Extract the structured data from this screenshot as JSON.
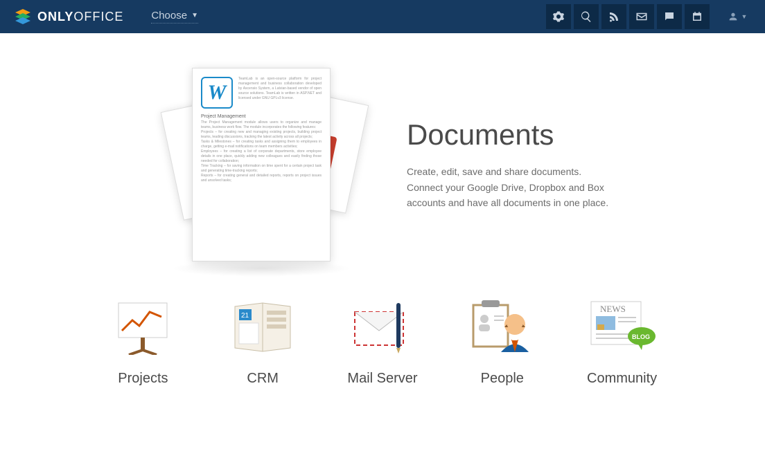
{
  "header": {
    "brand_prefix": "ONLY",
    "brand_suffix": "OFFICE",
    "choose_label": "Choose",
    "icons": [
      "settings",
      "search",
      "feed",
      "mail",
      "chat",
      "calendar"
    ]
  },
  "hero": {
    "title": "Documents",
    "description": "Create, edit, save and share documents. Connect your Google Drive, Dropbox and Box accounts and have all documents in one place.",
    "doc_preview": {
      "intro_heading": "TeamLab is an open-source platform for project management and business collaboration developed by Ascensio System, a Latvian-based vendor of open source solutions. TeamLab is written in ASP.NET and licensed under GNU GPLv3 license.",
      "section_title": "Project Management",
      "body1": "The Project Management module allows users to organize and manage teams, business work flow. The module incorporates the following features:",
      "body2": "Projects – for creating new and managing existing projects, building project teams, leading discussions, tracking the latest activity across all projects;",
      "body3": "Tasks & Milestones – for creating tasks and assigning them to employees in charge, getting e-mail notifications on team members activities;",
      "body4": "Employees – for creating a list of corporate departments, store employee details in one place, quickly adding new colleagues and easily finding those needed for collaboration;",
      "body5": "Time Tracking – for saving information on time spent for a certain project task and generating time-tracking reports;",
      "body6": "Reports – for creating general and detailed reports, reports on project issues and unsolved tasks;"
    }
  },
  "modules": [
    {
      "id": "projects",
      "label": "Projects"
    },
    {
      "id": "crm",
      "label": "CRM"
    },
    {
      "id": "mail",
      "label": "Mail Server"
    },
    {
      "id": "people",
      "label": "People"
    },
    {
      "id": "community",
      "label": "Community"
    }
  ]
}
